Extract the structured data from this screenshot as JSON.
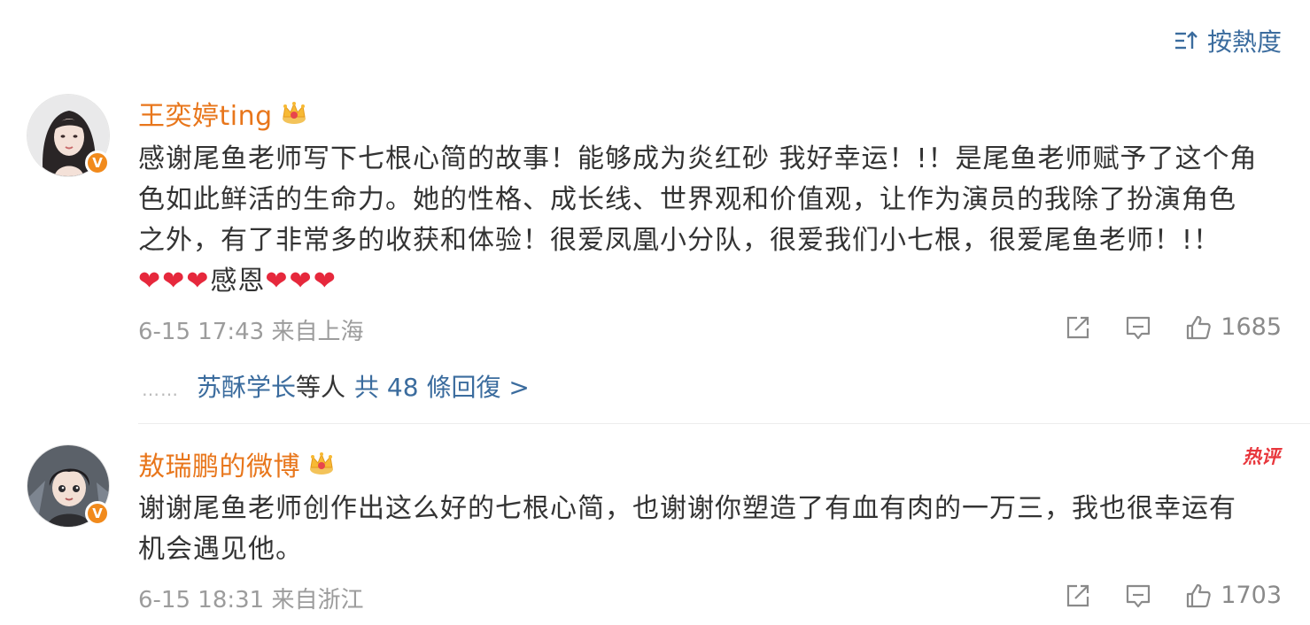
{
  "sort": {
    "label": "按熱度"
  },
  "comments": [
    {
      "name": "王奕婷ting",
      "text_lines": [
        "感谢尾鱼老师写下七根心简的故事！能够成为炎红砂 我好幸运！!！是尾鱼老师赋予了这个角",
        "色如此鲜活的生命力。她的性格、成长线、世界观和价值观，让作为演员的我除了扮演角色",
        "之外，有了非常多的收获和体验！很爱凤凰小分队，很爱我们小七根，很爱尾鱼老师！!！"
      ],
      "hearts_before": "❤❤❤",
      "emoji_text": "感恩",
      "hearts_after": "❤❤❤",
      "time": "6-15 17:43",
      "location": "来自上海",
      "likes": "1685",
      "badge": "V",
      "replies": {
        "dots": "……",
        "user": "苏酥学长",
        "middle": "等人",
        "count_text": "共 48 條回復 >"
      }
    },
    {
      "name": "敖瑞鹏的微博",
      "text_lines": [
        "谢谢尾鱼老师创作出这么好的七根心简，也谢谢你塑造了有血有肉的一万三，我也很幸运有",
        "机会遇见他。"
      ],
      "time": "6-15 18:31",
      "location": "来自浙江",
      "likes": "1703",
      "badge": "V",
      "hot_tag": "热评"
    }
  ],
  "colors": {
    "link": "#3b6c9e",
    "username": "#e8761b",
    "text": "#333333",
    "meta": "#9c9c9c",
    "heart": "#e6283c",
    "badge": "#f18a1c"
  },
  "icons": [
    "sort-icon",
    "crown-icon",
    "share-icon",
    "reply-icon",
    "like-icon",
    "verified-badge-icon"
  ]
}
